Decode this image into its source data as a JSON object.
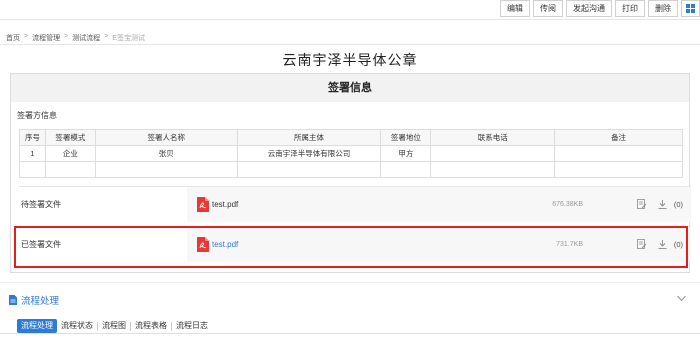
{
  "toolbar": {
    "edit": "编辑",
    "share": "传阅",
    "start_chat": "发起沟通",
    "print": "打印",
    "delete": "删除"
  },
  "breadcrumb": {
    "home": "首页",
    "process_mgmt": "流程管理",
    "test_process": "测试流程",
    "current": "E签宝测试"
  },
  "document": {
    "title": "云南宇泽半导体公章"
  },
  "sign_info": {
    "title": "签署信息",
    "party_section_label": "签署方信息",
    "columns": [
      "序号",
      "签署模式",
      "签署人名称",
      "所属主体",
      "签署地位",
      "联系电话",
      "备注"
    ],
    "rows": [
      [
        "1",
        "企业",
        "张贝",
        "云南宇泽半导体有限公司",
        "甲方",
        "",
        ""
      ]
    ],
    "pending_files": {
      "label": "待签署文件",
      "file_name": "test.pdf",
      "file_size": "676.38KB",
      "download_count": "(0)"
    },
    "signed_files": {
      "label": "已签署文件",
      "file_name": "test.pdf",
      "file_size": "731.7KB",
      "download_count": "(0)"
    }
  },
  "process": {
    "title": "流程处理",
    "tabs": [
      "流程处理",
      "流程状态",
      "流程图",
      "流程表格",
      "流程日志"
    ],
    "active_tab": "流程处理"
  },
  "colors": {
    "accent": "#2e7bd6",
    "highlight": "#e02020",
    "pdf": "#e53935"
  }
}
